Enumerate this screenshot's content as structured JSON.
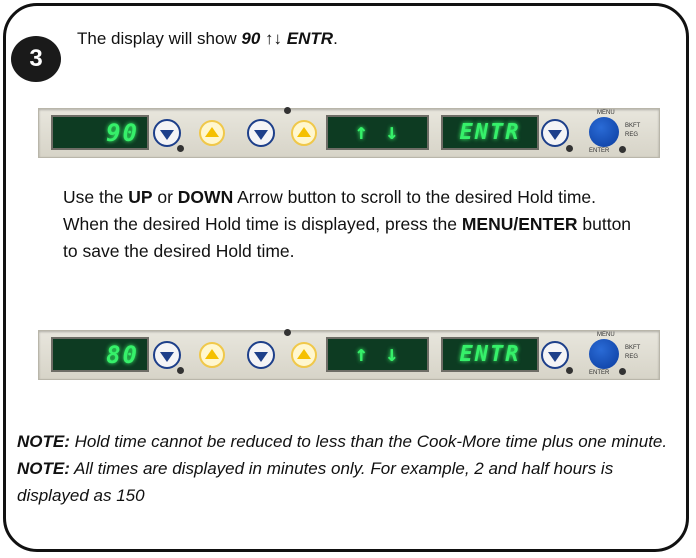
{
  "step": {
    "number": "3",
    "text_prefix": "The display will show ",
    "code_number": "90",
    "code_arrows": " ↑↓ ",
    "code_entr": "ENTR",
    "text_suffix": "."
  },
  "panels": [
    {
      "display_number": "90",
      "display_arrows": "↑ ↓",
      "display_text": "ENTR",
      "menu_label": "MENU",
      "enter_label": "ENTER",
      "bkft_label": "BKFT",
      "reg_label": "REG"
    },
    {
      "display_number": "80",
      "display_arrows": "↑ ↓",
      "display_text": "ENTR",
      "menu_label": "MENU",
      "enter_label": "ENTER",
      "bkft_label": "BKFT",
      "reg_label": "REG"
    }
  ],
  "instructions": {
    "t1": "Use the ",
    "up": "UP",
    "t2": " or ",
    "down": "DOWN",
    "t3": " Arrow button to scroll to the desired Hold time. When the desired Hold time is displayed, press the ",
    "menu_enter": "MENU/ENTER",
    "t4": " button to save the desired Hold time."
  },
  "note": {
    "label1": "NOTE:",
    "text1": " Hold time cannot be reduced to less than the Cook-More time plus one minute. ",
    "label2": "NOTE:",
    "text2": " All times are displayed in minutes only. For example, 2 and half hours is displayed as 150"
  }
}
